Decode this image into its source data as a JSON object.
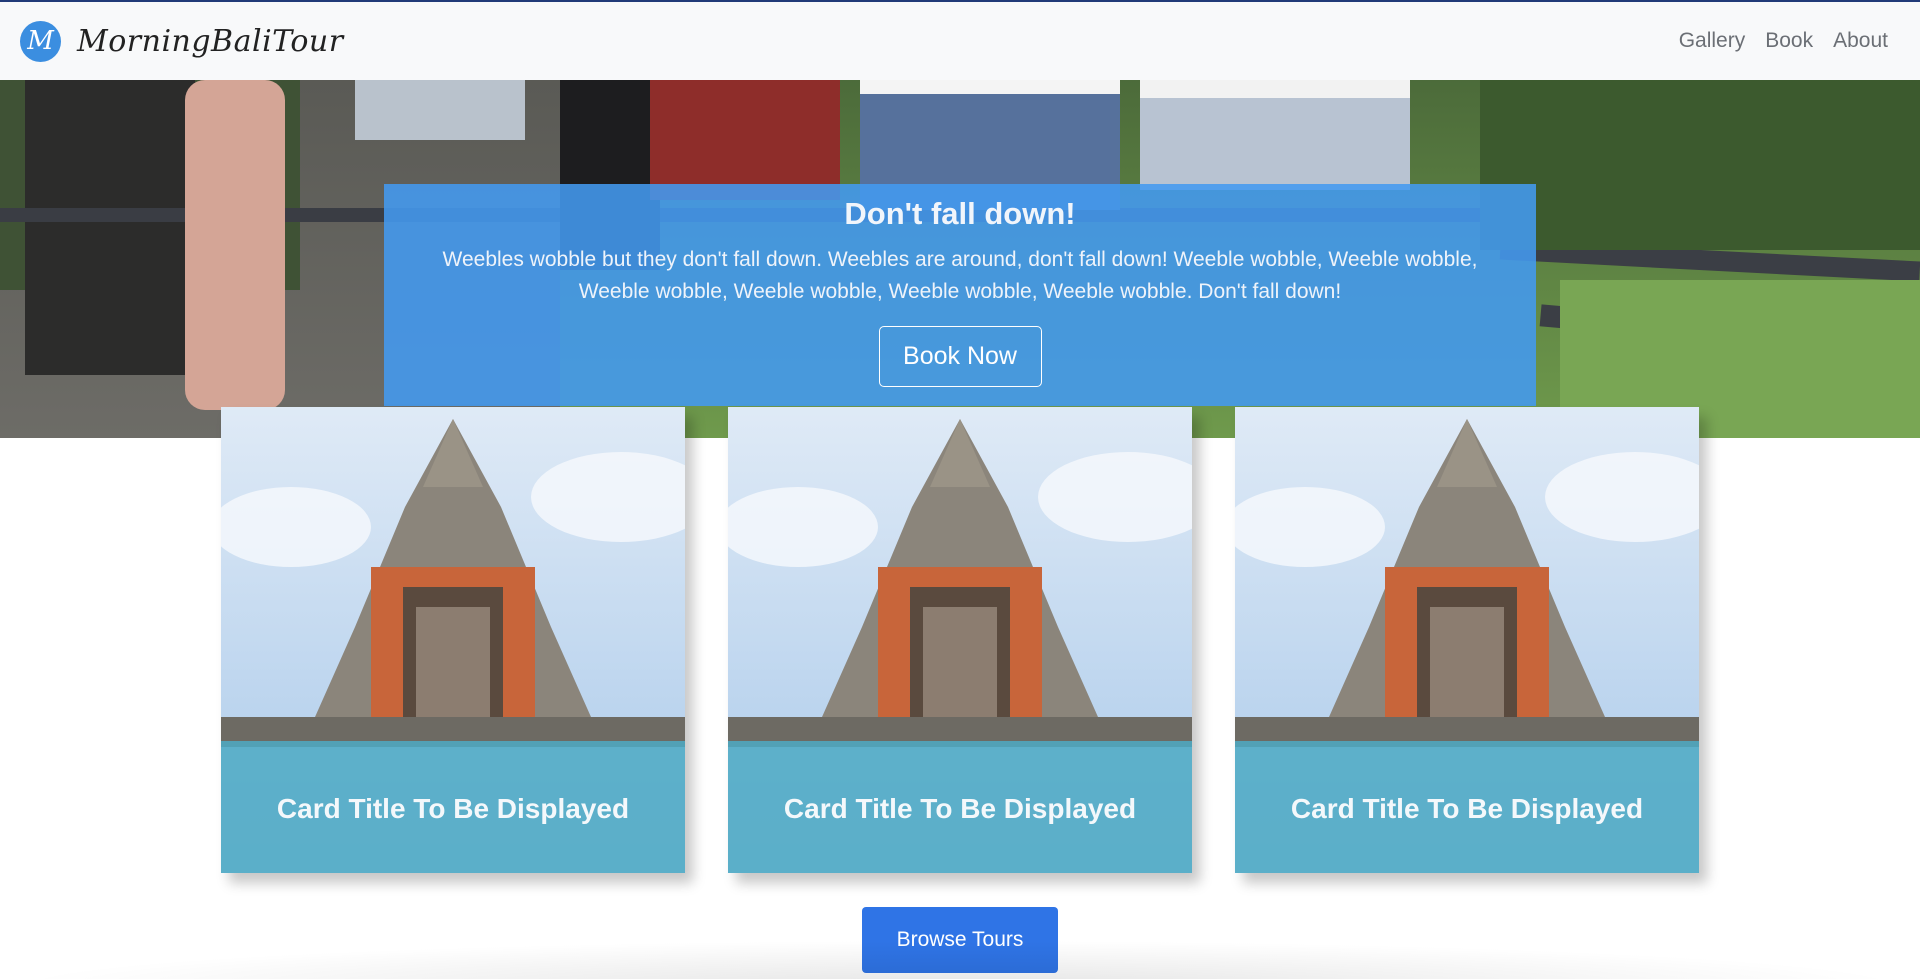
{
  "navbar": {
    "logo_letter": "M",
    "brand": "MorningBaliTour",
    "links": [
      "Gallery",
      "Book",
      "About"
    ]
  },
  "hero": {
    "title": "Don't fall down!",
    "text": "Weebles wobble but they don't fall down. Weebles are around, don't fall down! Weeble wobble, Weeble wobble, Weeble wobble, Weeble wobble, Weeble wobble, Weeble wobble. Don't fall down!",
    "button": "Book Now"
  },
  "cards": [
    {
      "title": "Card Title To Be Displayed"
    },
    {
      "title": "Card Title To Be Displayed"
    },
    {
      "title": "Card Title To Be Displayed"
    }
  ],
  "browse_button": "Browse Tours",
  "colors": {
    "accent": "#2f74e6",
    "hero_panel": "#439af0",
    "card_overlay": "#4eaac4",
    "navbar_bg": "#f8f9fa"
  }
}
